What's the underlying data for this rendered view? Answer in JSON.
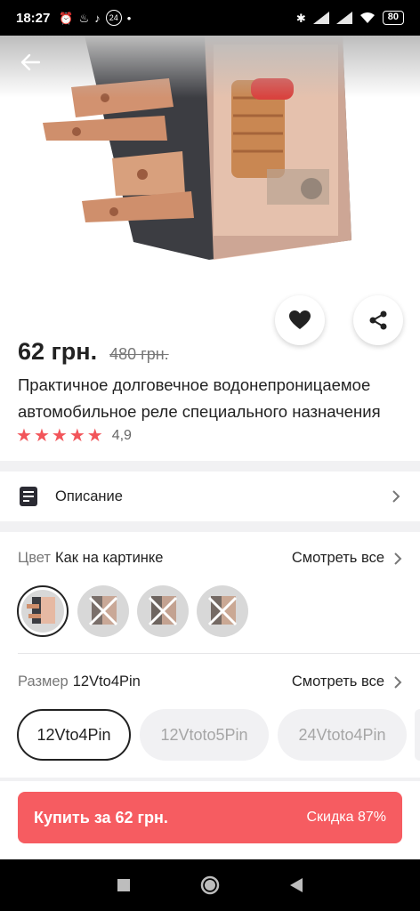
{
  "status_bar": {
    "time": "18:27",
    "left_icons": [
      "alarm-icon",
      "app-icon",
      "music-icon",
      "badge-24-icon",
      "dot-icon"
    ],
    "badge_text": "24",
    "right_icons": [
      "bluetooth-icon",
      "signal-icon",
      "signal-icon",
      "wifi-icon",
      "battery-icon"
    ],
    "battery": "80"
  },
  "product": {
    "price": "62 грн.",
    "old_price": "480 грн.",
    "title": "Практичное долговечное водонепроницаемое автомобильное реле специального назначения",
    "rating": "4,9",
    "rating_stars": 5
  },
  "description": {
    "label": "Описание"
  },
  "color_option": {
    "key": "Цвет",
    "value": "Как на картинке",
    "see_all": "Смотреть все",
    "swatches_count": 4,
    "selected_index": 0
  },
  "size_option": {
    "key": "Размер",
    "value": "12Vto4Pin",
    "see_all": "Смотреть все",
    "chips": [
      "12Vto4Pin",
      "12Vtoto5Pin",
      "24Vtoto4Pin"
    ]
  },
  "buy": {
    "label": "Купить за 62 грн.",
    "discount": "Скидка 87%"
  },
  "colors": {
    "accent": "#f65c61",
    "star": "#f2555a",
    "divider": "#f1f1f3"
  }
}
